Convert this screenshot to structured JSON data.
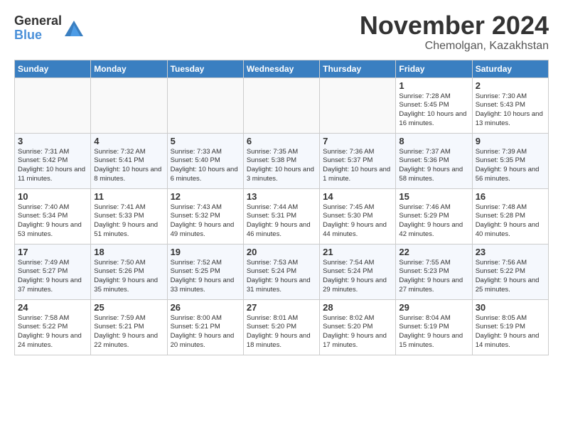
{
  "header": {
    "logo": {
      "general": "General",
      "blue": "Blue"
    },
    "title": "November 2024",
    "location": "Chemolgan, Kazakhstan"
  },
  "weekdays": [
    "Sunday",
    "Monday",
    "Tuesday",
    "Wednesday",
    "Thursday",
    "Friday",
    "Saturday"
  ],
  "weeks": [
    [
      {
        "day": "",
        "info": ""
      },
      {
        "day": "",
        "info": ""
      },
      {
        "day": "",
        "info": ""
      },
      {
        "day": "",
        "info": ""
      },
      {
        "day": "",
        "info": ""
      },
      {
        "day": "1",
        "info": "Sunrise: 7:28 AM\nSunset: 5:45 PM\nDaylight: 10 hours and 16 minutes."
      },
      {
        "day": "2",
        "info": "Sunrise: 7:30 AM\nSunset: 5:43 PM\nDaylight: 10 hours and 13 minutes."
      }
    ],
    [
      {
        "day": "3",
        "info": "Sunrise: 7:31 AM\nSunset: 5:42 PM\nDaylight: 10 hours and 11 minutes."
      },
      {
        "day": "4",
        "info": "Sunrise: 7:32 AM\nSunset: 5:41 PM\nDaylight: 10 hours and 8 minutes."
      },
      {
        "day": "5",
        "info": "Sunrise: 7:33 AM\nSunset: 5:40 PM\nDaylight: 10 hours and 6 minutes."
      },
      {
        "day": "6",
        "info": "Sunrise: 7:35 AM\nSunset: 5:38 PM\nDaylight: 10 hours and 3 minutes."
      },
      {
        "day": "7",
        "info": "Sunrise: 7:36 AM\nSunset: 5:37 PM\nDaylight: 10 hours and 1 minute."
      },
      {
        "day": "8",
        "info": "Sunrise: 7:37 AM\nSunset: 5:36 PM\nDaylight: 9 hours and 58 minutes."
      },
      {
        "day": "9",
        "info": "Sunrise: 7:39 AM\nSunset: 5:35 PM\nDaylight: 9 hours and 56 minutes."
      }
    ],
    [
      {
        "day": "10",
        "info": "Sunrise: 7:40 AM\nSunset: 5:34 PM\nDaylight: 9 hours and 53 minutes."
      },
      {
        "day": "11",
        "info": "Sunrise: 7:41 AM\nSunset: 5:33 PM\nDaylight: 9 hours and 51 minutes."
      },
      {
        "day": "12",
        "info": "Sunrise: 7:43 AM\nSunset: 5:32 PM\nDaylight: 9 hours and 49 minutes."
      },
      {
        "day": "13",
        "info": "Sunrise: 7:44 AM\nSunset: 5:31 PM\nDaylight: 9 hours and 46 minutes."
      },
      {
        "day": "14",
        "info": "Sunrise: 7:45 AM\nSunset: 5:30 PM\nDaylight: 9 hours and 44 minutes."
      },
      {
        "day": "15",
        "info": "Sunrise: 7:46 AM\nSunset: 5:29 PM\nDaylight: 9 hours and 42 minutes."
      },
      {
        "day": "16",
        "info": "Sunrise: 7:48 AM\nSunset: 5:28 PM\nDaylight: 9 hours and 40 minutes."
      }
    ],
    [
      {
        "day": "17",
        "info": "Sunrise: 7:49 AM\nSunset: 5:27 PM\nDaylight: 9 hours and 37 minutes."
      },
      {
        "day": "18",
        "info": "Sunrise: 7:50 AM\nSunset: 5:26 PM\nDaylight: 9 hours and 35 minutes."
      },
      {
        "day": "19",
        "info": "Sunrise: 7:52 AM\nSunset: 5:25 PM\nDaylight: 9 hours and 33 minutes."
      },
      {
        "day": "20",
        "info": "Sunrise: 7:53 AM\nSunset: 5:24 PM\nDaylight: 9 hours and 31 minutes."
      },
      {
        "day": "21",
        "info": "Sunrise: 7:54 AM\nSunset: 5:24 PM\nDaylight: 9 hours and 29 minutes."
      },
      {
        "day": "22",
        "info": "Sunrise: 7:55 AM\nSunset: 5:23 PM\nDaylight: 9 hours and 27 minutes."
      },
      {
        "day": "23",
        "info": "Sunrise: 7:56 AM\nSunset: 5:22 PM\nDaylight: 9 hours and 25 minutes."
      }
    ],
    [
      {
        "day": "24",
        "info": "Sunrise: 7:58 AM\nSunset: 5:22 PM\nDaylight: 9 hours and 24 minutes."
      },
      {
        "day": "25",
        "info": "Sunrise: 7:59 AM\nSunset: 5:21 PM\nDaylight: 9 hours and 22 minutes."
      },
      {
        "day": "26",
        "info": "Sunrise: 8:00 AM\nSunset: 5:21 PM\nDaylight: 9 hours and 20 minutes."
      },
      {
        "day": "27",
        "info": "Sunrise: 8:01 AM\nSunset: 5:20 PM\nDaylight: 9 hours and 18 minutes."
      },
      {
        "day": "28",
        "info": "Sunrise: 8:02 AM\nSunset: 5:20 PM\nDaylight: 9 hours and 17 minutes."
      },
      {
        "day": "29",
        "info": "Sunrise: 8:04 AM\nSunset: 5:19 PM\nDaylight: 9 hours and 15 minutes."
      },
      {
        "day": "30",
        "info": "Sunrise: 8:05 AM\nSunset: 5:19 PM\nDaylight: 9 hours and 14 minutes."
      }
    ]
  ]
}
